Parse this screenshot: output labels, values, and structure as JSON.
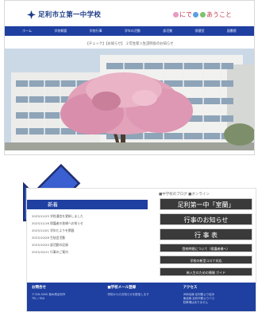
{
  "site": {
    "logo_text": "足利市立第一中学校",
    "tagline_a": "",
    "tagline_b": "にで",
    "tagline_c": "あうこと"
  },
  "nav": {
    "items": [
      "ホーム",
      "学校概要",
      "学校行事",
      "学年の活動",
      "部活動",
      "保健室",
      "図書館"
    ]
  },
  "notice": "【チェック】【お知らせ】 ２年生新入生説明会のお知らせ",
  "news": {
    "heading": "新着",
    "items": [
      "2023/11/25 学校通信を更新しました",
      "2023/11/16 保護者の皆様へお知らせ",
      "2023/11/01 学年だよりを掲載",
      "2023/10/28 生徒会活動",
      "2023/10/20 部活動の記録",
      "2023/10/11 行事のご案内"
    ]
  },
  "side": {
    "title": "■中学校のブログ ■オンライン",
    "buttons": [
      {
        "label": "足利第一中「室蘭」",
        "size": "big"
      },
      {
        "label": "行事のお知らせ",
        "size": "big"
      },
      {
        "label": "行 事 表",
        "size": "big"
      },
      {
        "label": "登校時間について（保護者様へ）",
        "size": "small"
      },
      {
        "label": "学校の新型コロナ対応",
        "size": "small"
      },
      {
        "label": "新入生のための情報 ガイド",
        "size": "small"
      }
    ]
  },
  "footer": {
    "col1": {
      "head": "お問合せ",
      "lines": [
        "〒326-0000 栃木県足利市",
        "TEL / FAX"
      ]
    },
    "col2": {
      "head": "■学校メール登録",
      "lines": [
        "学校からのお知らせを配信します"
      ]
    },
    "col3": {
      "head": "アクセス",
      "lines": [
        "JR両毛線 足利駅より徒歩",
        "東武線 足利市駅よりバス",
        "駐車場はありません"
      ]
    }
  },
  "colors": {
    "brand": "#1f40a0",
    "tagline": "#c0354a",
    "button": "#3a3a3a"
  }
}
